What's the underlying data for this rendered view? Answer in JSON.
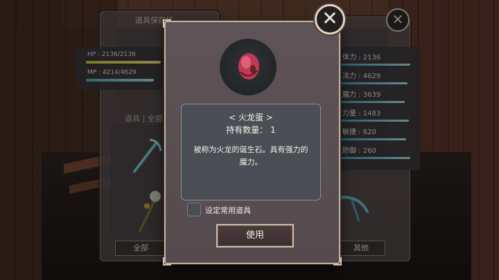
{
  "background_panel_left": {
    "title": "道具保存栏",
    "hp_text": "HP : 2136/2136",
    "mp_text": "MP : 4214/4629",
    "hp_fraction": 1.0,
    "mp_fraction": 0.91,
    "tab_label": "道具 | 全部",
    "button_all": "全部"
  },
  "background_panel_right": {
    "stats": [
      {
        "label": "体力 : 2136"
      },
      {
        "label": "法力 : 4629"
      },
      {
        "label": "魔力 : 3639"
      },
      {
        "label": "力量 : 1483"
      },
      {
        "label": "敏捷 : 620"
      },
      {
        "label": "防御 : 260"
      }
    ],
    "button_other": "其他"
  },
  "dialog": {
    "item_name": "< 火龙蛋 >",
    "item_count": "持有数量： 1",
    "item_description": "被称为火龙的诞生石。具有强力的魔力。",
    "favorite_label": "设定常用道具",
    "use_button": "使用",
    "close_symbol": "✕"
  },
  "colors": {
    "hp_bar": "#e6e25a",
    "mp_bar": "#7fd6e0",
    "dialog_border": "#c3b4a2",
    "egg": "#c23a52"
  }
}
